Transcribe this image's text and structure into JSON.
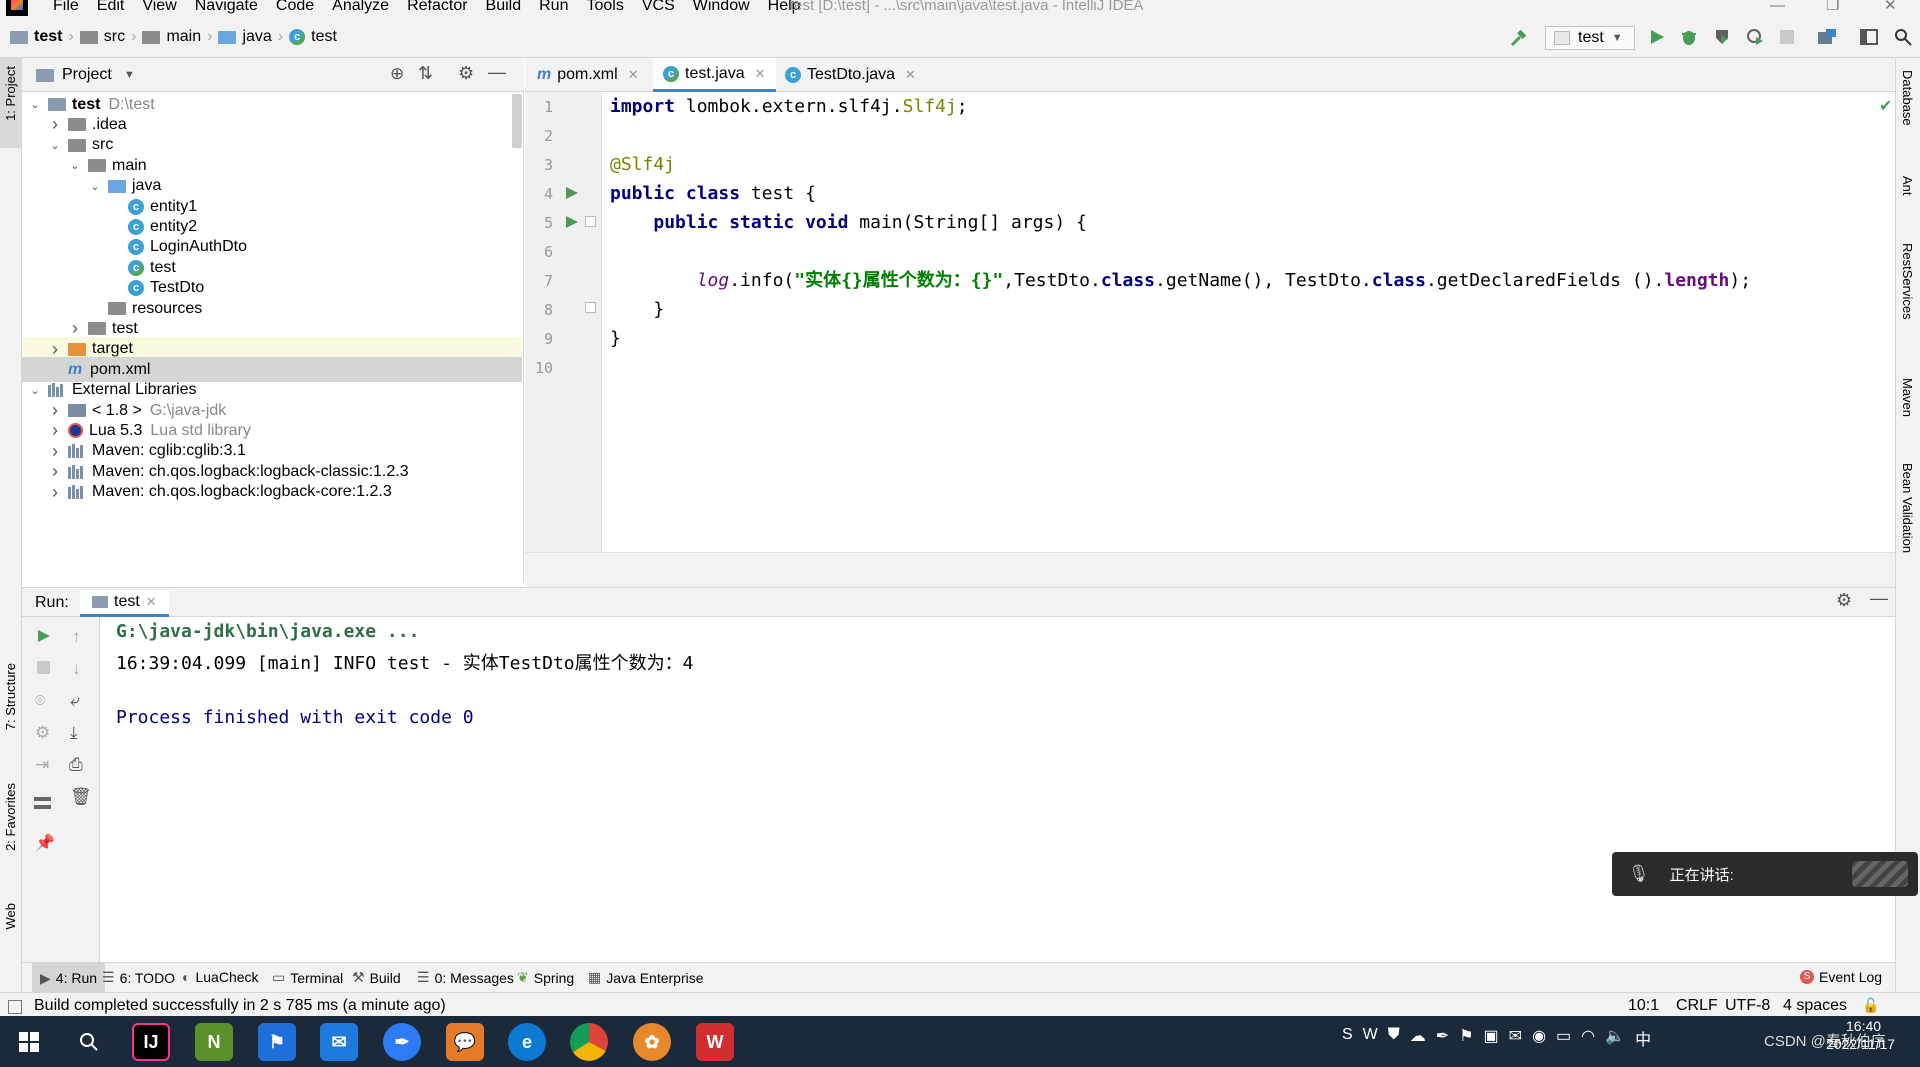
{
  "menubar": {
    "items": [
      "File",
      "Edit",
      "View",
      "Navigate",
      "Code",
      "Analyze",
      "Refactor",
      "Build",
      "Run",
      "Tools",
      "VCS",
      "Window",
      "Help"
    ],
    "window_title": "test [D:\\test] - ...\\src\\main\\java\\test.java - IntelliJ IDEA"
  },
  "breadcrumb": [
    "test",
    "src",
    "main",
    "java",
    "test"
  ],
  "run_config": {
    "label": "test"
  },
  "left_stripe": {
    "project": "1: Project",
    "structure": "7: Structure",
    "favorites": "2: Favorites",
    "web": "Web"
  },
  "right_stripe": [
    "Database",
    "Ant",
    "RestServices",
    "Maven",
    "Bean Validation"
  ],
  "project_panel": {
    "title": "Project",
    "tree": [
      {
        "label": "test",
        "hint": "D:\\test",
        "depth": 0,
        "arrow": "open",
        "icon": "module-folder",
        "bold": true
      },
      {
        "label": ".idea",
        "depth": 1,
        "arrow": "closed",
        "icon": "folder"
      },
      {
        "label": "src",
        "depth": 1,
        "arrow": "open",
        "icon": "folder"
      },
      {
        "label": "main",
        "depth": 2,
        "arrow": "open",
        "icon": "folder"
      },
      {
        "label": "java",
        "depth": 3,
        "arrow": "open",
        "icon": "source-folder"
      },
      {
        "label": "entity1",
        "depth": 4,
        "icon": "class"
      },
      {
        "label": "entity2",
        "depth": 4,
        "icon": "class"
      },
      {
        "label": "LoginAuthDto",
        "depth": 4,
        "icon": "class"
      },
      {
        "label": "test",
        "depth": 4,
        "icon": "class-runnable"
      },
      {
        "label": "TestDto",
        "depth": 4,
        "icon": "class"
      },
      {
        "label": "resources",
        "depth": 3,
        "icon": "resources-folder"
      },
      {
        "label": "test",
        "depth": 2,
        "arrow": "closed",
        "icon": "folder"
      },
      {
        "label": "target",
        "depth": 1,
        "arrow": "closed",
        "icon": "orange-folder",
        "state": "highlight"
      },
      {
        "label": "pom.xml",
        "depth": 1,
        "icon": "maven",
        "state": "selected"
      },
      {
        "label": "External Libraries",
        "depth": 0,
        "arrow": "open",
        "icon": "library"
      },
      {
        "label": "< 1.8 >",
        "hint": "G:\\java-jdk",
        "depth": 1,
        "arrow": "closed",
        "icon": "jdk"
      },
      {
        "label": "Lua 5.3",
        "hint": "Lua std library",
        "depth": 1,
        "arrow": "closed",
        "icon": "lua"
      },
      {
        "label": "Maven: cglib:cglib:3.1",
        "depth": 1,
        "arrow": "closed",
        "icon": "library"
      },
      {
        "label": "Maven: ch.qos.logback:logback-classic:1.2.3",
        "depth": 1,
        "arrow": "closed",
        "icon": "library"
      },
      {
        "label": "Maven: ch.qos.logback:logback-core:1.2.3",
        "depth": 1,
        "arrow": "closed",
        "icon": "library"
      }
    ]
  },
  "editor": {
    "tabs": [
      {
        "label": "pom.xml",
        "icon": "maven",
        "active": false
      },
      {
        "label": "test.java",
        "icon": "class-runnable",
        "active": true
      },
      {
        "label": "TestDto.java",
        "icon": "class",
        "active": false
      }
    ],
    "line_numbers": [
      "1",
      "2",
      "3",
      "4",
      "5",
      "6",
      "7",
      "8",
      "9",
      "10"
    ],
    "code": {
      "l1_kw": "import",
      "l1_rest": " lombok.extern.slf4j.",
      "l1_cls": "Slf4j",
      "l1_end": ";",
      "l3_ann": "@Slf4j",
      "l4_kw": "public class",
      "l4_rest": " test {",
      "l5_indent": "    ",
      "l5_kw": "public static void",
      "l5_rest": " main(String[] args) {",
      "l7_indent": "        ",
      "l7_log": "log",
      "l7_a": ".info(",
      "l7_str": "\"实体{}属性个数为：{}\"",
      "l7_b": ",TestDto.",
      "l7_kw1": "class",
      "l7_c": ".getName(), TestDto.",
      "l7_kw2": "class",
      "l7_d": ".getDeclaredFields ().",
      "l7_fld": "length",
      "l7_e": ");",
      "l8": "    }",
      "l9": "}"
    }
  },
  "run_panel": {
    "label": "Run:",
    "tab": "test",
    "console": {
      "cmd": "G:\\java-jdk\\bin\\java.exe ...",
      "log": "16:39:04.099 [main] INFO test - 实体TestDto属性个数为：4",
      "exit": "Process finished with exit code 0"
    }
  },
  "tool_tabs": [
    {
      "label": "4: Run",
      "icon": "run-icon",
      "active": true
    },
    {
      "label": "6: TODO",
      "icon": "todo-icon"
    },
    {
      "label": "LuaCheck",
      "icon": "luacheck-icon"
    },
    {
      "label": "Terminal",
      "icon": "terminal-icon"
    },
    {
      "label": "Build",
      "icon": "build-icon"
    },
    {
      "label": "0: Messages",
      "icon": "messages-icon"
    },
    {
      "label": "Spring",
      "icon": "spring-icon"
    },
    {
      "label": "Java Enterprise",
      "icon": "java-enterprise-icon"
    }
  ],
  "event_log": "Event Log",
  "status": {
    "message": "Build completed successfully in 2 s 785 ms (a minute ago)",
    "position": "10:1",
    "line_sep": "CRLF",
    "encoding": "UTF-8",
    "indent": "4 spaces"
  },
  "notification": {
    "text": "正在讲话:"
  },
  "taskbar": {
    "time": "16:40",
    "date": "2022/11/17",
    "watermark": "CSDN @春秋伯序"
  },
  "colors": {
    "accent": "#4083c9",
    "run_green": "#499c54",
    "keyword": "#000080",
    "string": "#008000",
    "annotation": "#808000"
  }
}
